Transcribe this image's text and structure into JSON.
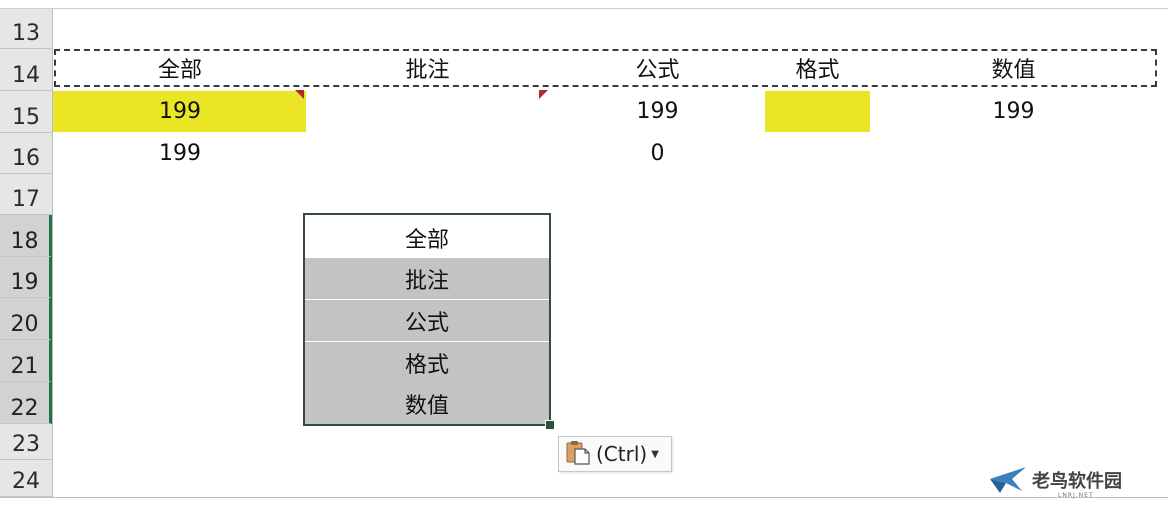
{
  "row_numbers": [
    "13",
    "14",
    "15",
    "16",
    "17",
    "18",
    "19",
    "20",
    "21",
    "22",
    "23",
    "24"
  ],
  "sheet": {
    "header": {
      "all": "全部",
      "comment": "批注",
      "formula": "公式",
      "format": "格式",
      "value": "数值"
    },
    "row15": {
      "all": "199",
      "formula": "199",
      "value": "199"
    },
    "row16": {
      "all": "199",
      "formula": "0"
    }
  },
  "dropdown": {
    "items": [
      "全部",
      "批注",
      "公式",
      "格式",
      "数值"
    ]
  },
  "paste_options": {
    "label": "(Ctrl)",
    "icon": "clipboard-icon"
  },
  "watermark": {
    "text": "老鸟软件园",
    "sub": "LNRJ.NET"
  },
  "colors": {
    "highlight": "#ebe625",
    "comment_marker": "#b3272d",
    "selection_border": "#2f4f3a",
    "dropdown_gray": "#c3c3c3"
  }
}
